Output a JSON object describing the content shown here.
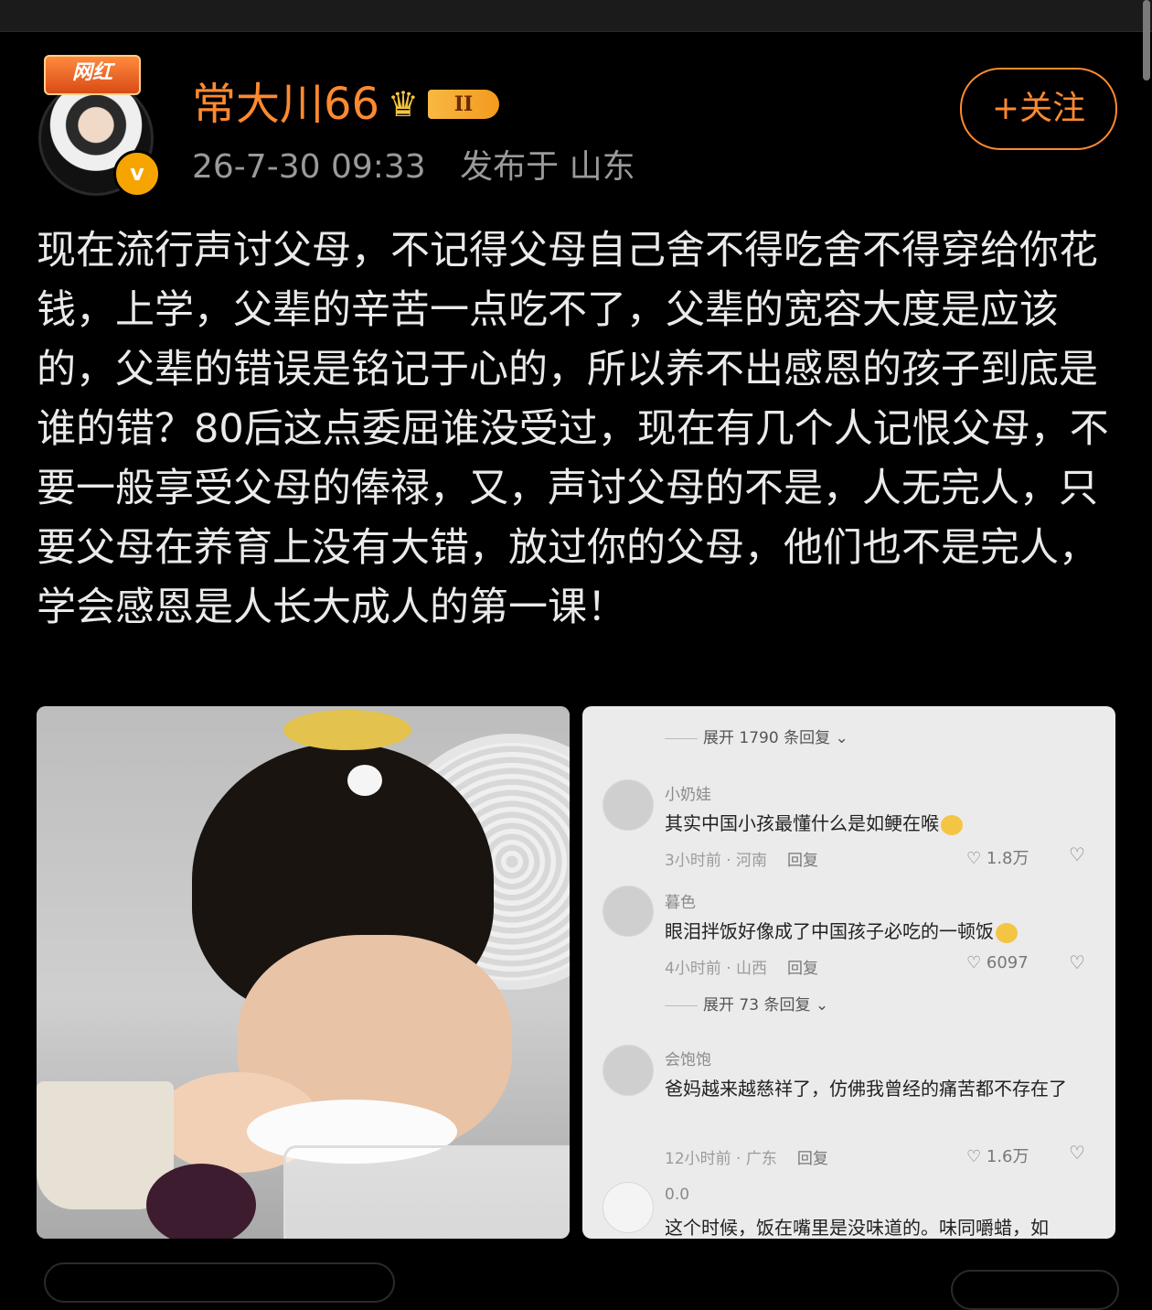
{
  "post": {
    "badge": "网红",
    "verified_mark": "v",
    "username": "常大川66",
    "level": "II",
    "datetime": "26-7-30 09:33",
    "location": "发布于 山东",
    "follow_label": "+关注",
    "text": "现在流行声讨父母，不记得父母自己舍不得吃舍不得穿给你花钱，上学，父辈的辛苦一点吃不了，父辈的宽容大度是应该的，父辈的错误是铭记于心的，所以养不出感恩的孩子到底是谁的错？80后这点委屈谁没受过，现在有几个人记恨父母，不要一般享受父母的俸禄，又，声讨父母的不是，人无完人，只要父母在养育上没有大错，放过你的父母，他们也不是完人，学会感恩是人长大成人的第一课！"
  },
  "comments_image": {
    "expand_top": "展开 1790 条回复",
    "comments": [
      {
        "name": "小奶娃",
        "text": "其实中国小孩最懂什么是如鲠在喉",
        "time": "3小时前 · 河南",
        "reply": "回复",
        "likes": "1.8万"
      },
      {
        "name": "暮色",
        "text": "眼泪拌饭好像成了中国孩子必吃的一顿饭",
        "time": "4小时前 · 山西",
        "reply": "回复",
        "likes": "6097"
      },
      {
        "name": "会饱饱",
        "text": "爸妈越来越慈祥了，仿佛我曾经的痛苦都不存在了",
        "time": "12小时前 · 广东",
        "reply": "回复",
        "likes": "1.6万"
      },
      {
        "name": "0.0",
        "text": "这个时候，饭在嘴里是没味道的。味同嚼蜡，如"
      }
    ],
    "expand_mid": "展开 73 条回复"
  },
  "icons": {
    "crown": "crown-icon",
    "heart": "♡",
    "dislike": "♡",
    "chevron": "⌄"
  }
}
